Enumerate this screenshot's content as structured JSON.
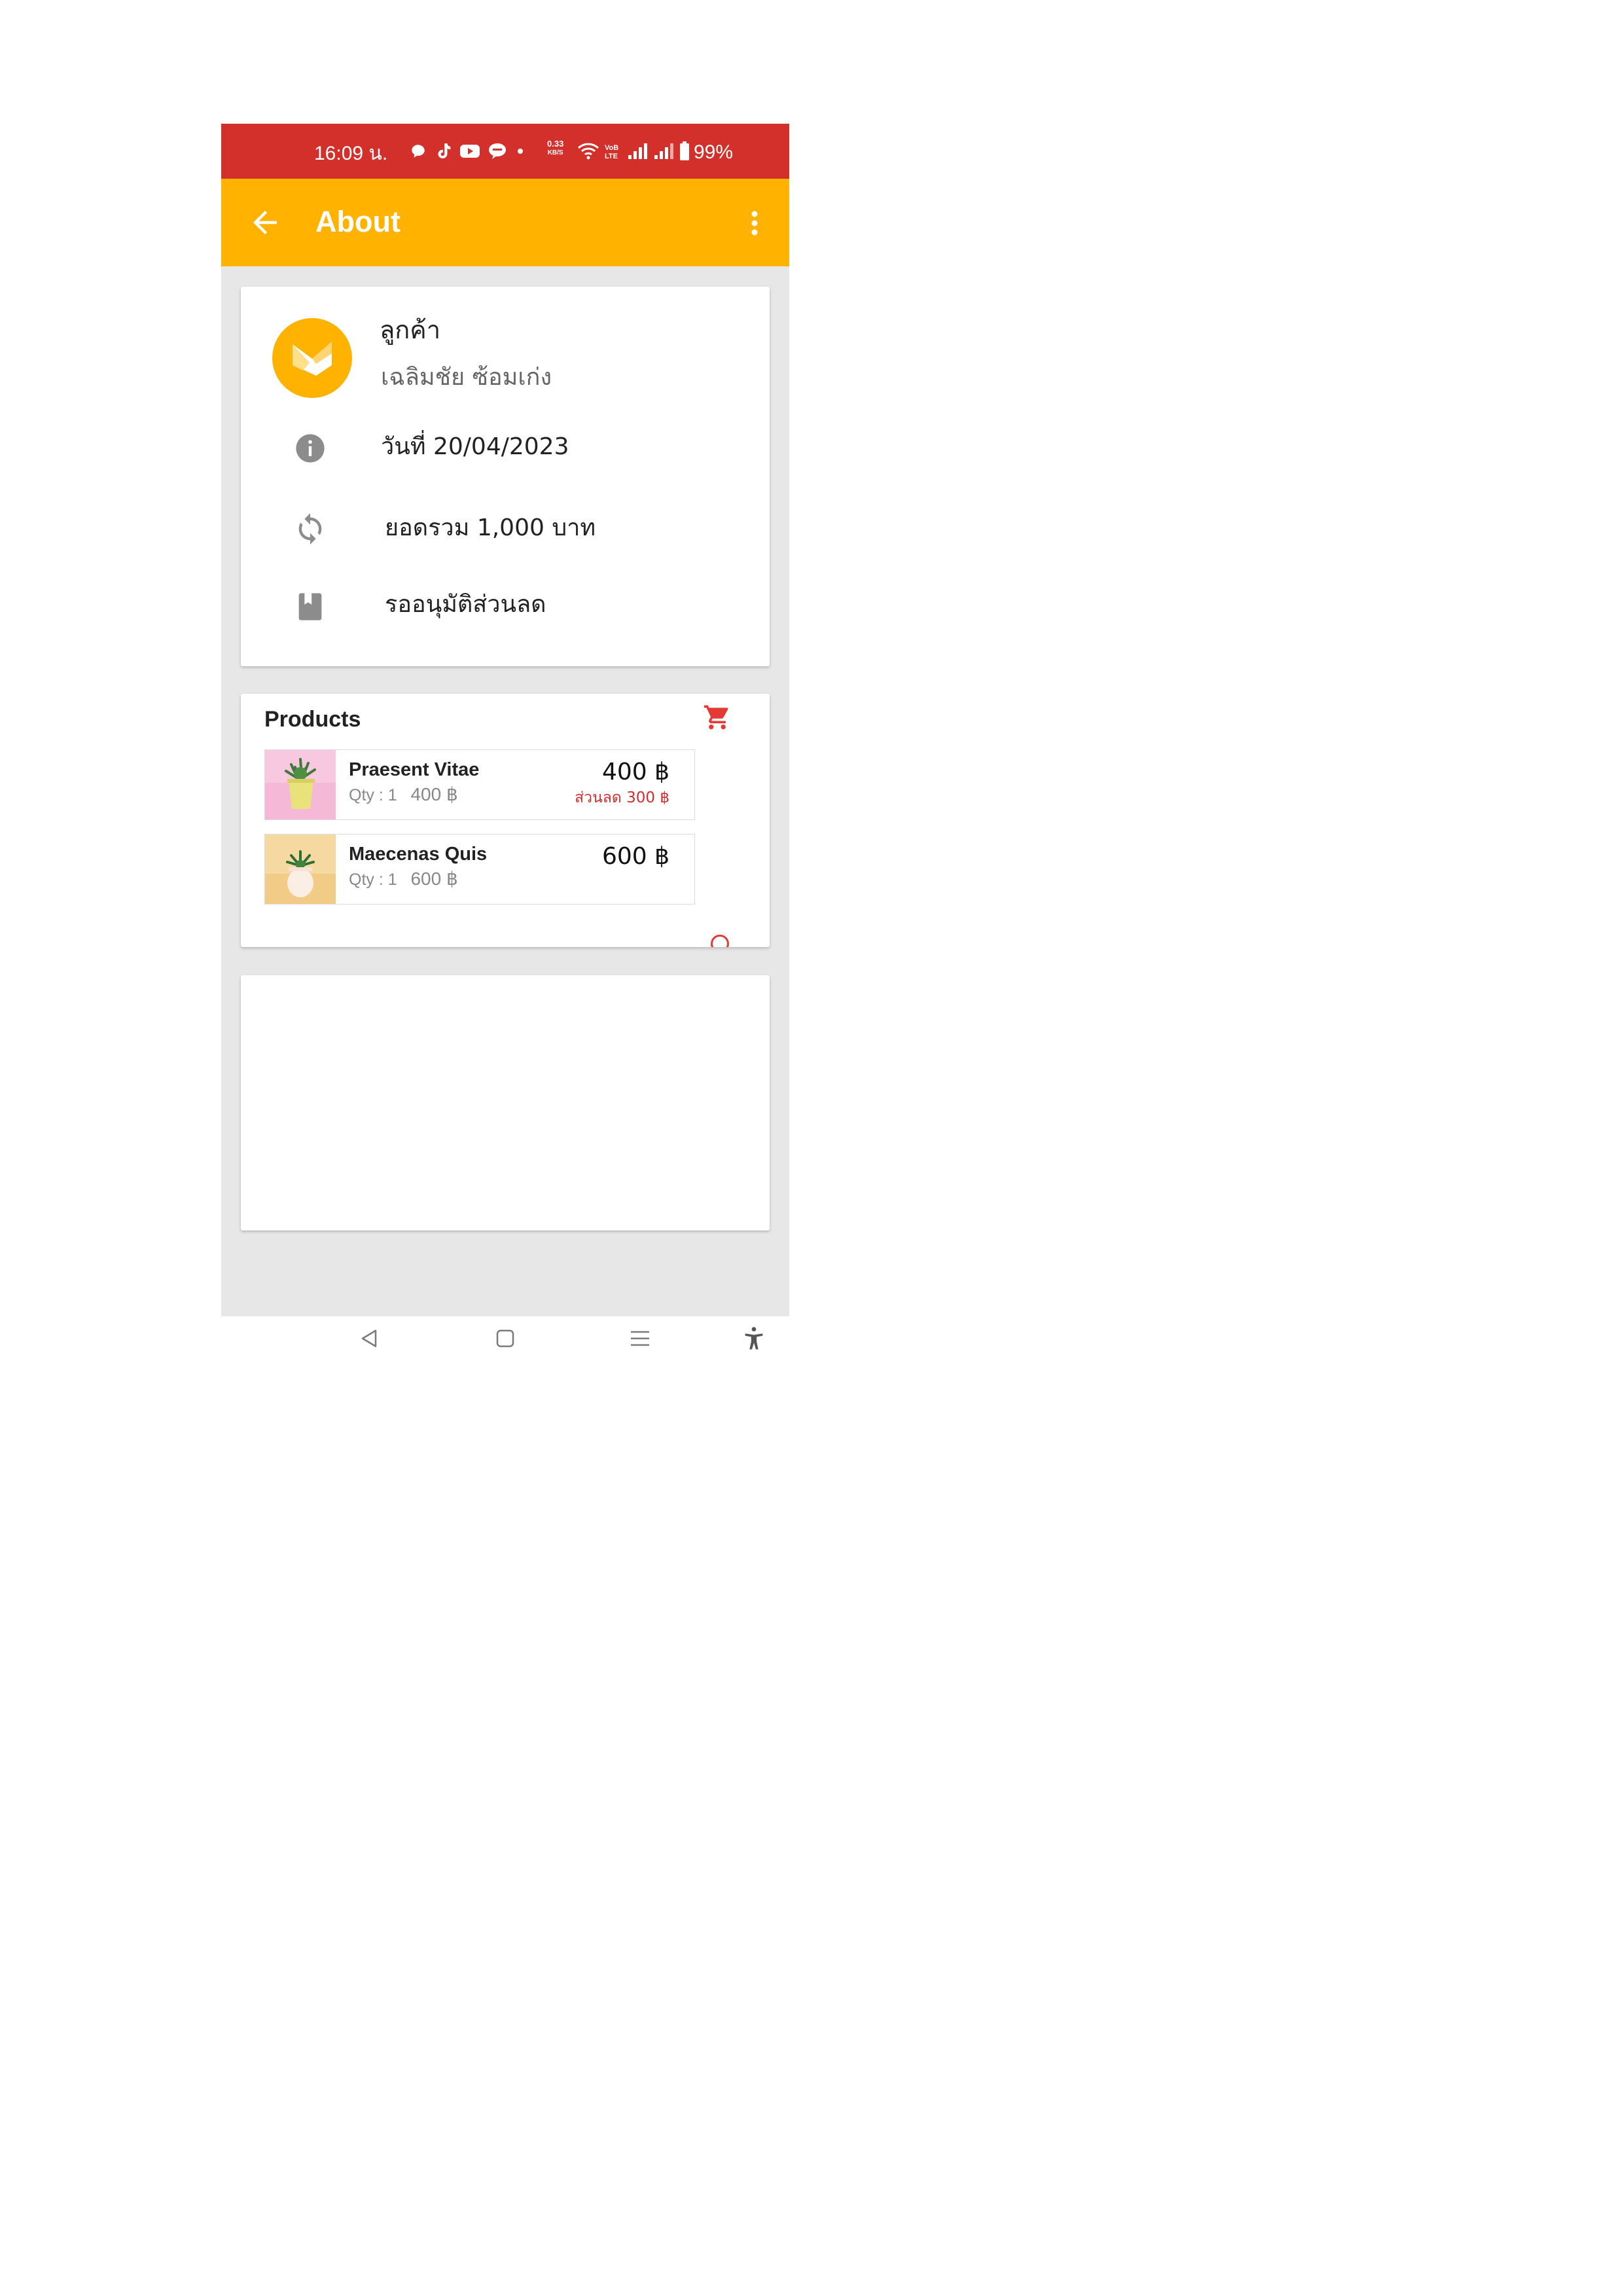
{
  "status_bar": {
    "time": "16:09 น.",
    "speed_value": "0.33",
    "speed_unit": "KB/S",
    "battery_text": "99%",
    "icons": [
      "chat-icon",
      "tiktok-icon",
      "youtube-icon",
      "line-icon",
      "dot-icon",
      "wifi-icon",
      "volte-icon",
      "signal-icon",
      "signal-icon",
      "battery-icon"
    ]
  },
  "app_bar": {
    "title": "About",
    "back_icon": "arrow-back-icon",
    "menu_icon": "more-vertical-icon"
  },
  "info_card": {
    "customer_label": "ลูกค้า",
    "customer_name": "เฉลิมชัย ซ้อมเก่ง",
    "date": "วันที่ 20/04/2023",
    "total": "ยอดรวม 1,000 บาท",
    "status": "รออนุมัติส่วนลด"
  },
  "products_card": {
    "title": "Products",
    "items": [
      {
        "name": "Praesent Vitae",
        "qty_label": "Qty : 1",
        "unit_price": "400 ฿",
        "price": "400 ฿",
        "discount": "ส่วนลด 300 ฿"
      },
      {
        "name": "Maecenas Quis",
        "qty_label": "Qty : 1",
        "unit_price": "600 ฿",
        "price": "600 ฿",
        "discount": ""
      }
    ]
  },
  "colors": {
    "status_bar": "#d3302b",
    "app_bar": "#ffb300",
    "background": "#e7e7e7",
    "accent_red": "#e53935",
    "icon_grey": "#8c8c8c"
  }
}
